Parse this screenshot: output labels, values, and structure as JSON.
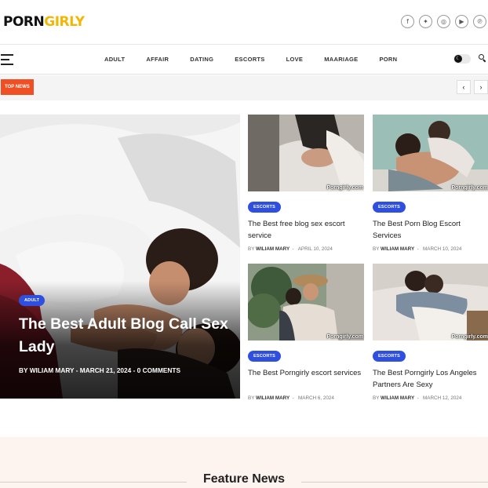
{
  "logo": {
    "part1": "PORN",
    "part2": "GIRLY"
  },
  "socials": [
    {
      "icon": "facebook-icon",
      "glyph": "f"
    },
    {
      "icon": "twitter-icon",
      "glyph": "✦"
    },
    {
      "icon": "instagram-icon",
      "glyph": "◎"
    },
    {
      "icon": "youtube-icon",
      "glyph": "▶"
    },
    {
      "icon": "pinterest-icon",
      "glyph": "℗"
    }
  ],
  "nav": {
    "items": [
      "ADULT",
      "AFFAIR",
      "DATING",
      "ESCORTS",
      "LOVE",
      "MAARIAGE",
      "PORN"
    ]
  },
  "topbar": {
    "label": "TOP NEWS",
    "prev": "‹",
    "next": "›"
  },
  "hero": {
    "category": "ADULT",
    "title": "The Best Adult Blog Call Sex Lady",
    "by": "BY",
    "author": "WILIAM MARY",
    "date": "MARCH 21, 2024",
    "comments": "0 COMMENTS"
  },
  "cards": [
    {
      "category": "ESCORTS",
      "title": "The Best free blog sex escort service",
      "by": "BY",
      "author": "WILIAM MARY",
      "date": "APRIL 10, 2024",
      "watermark": "Porngirly.com"
    },
    {
      "category": "ESCORTS",
      "title": "The Best Porn Blog Escort Services",
      "by": "BY",
      "author": "WILIAM MARY",
      "date": "MARCH 10, 2024",
      "watermark": "Porngirly.com"
    },
    {
      "category": "ESCORTS",
      "title": "The Best Porngirly escort services",
      "by": "BY",
      "author": "WILIAM MARY",
      "date": "MARCH 6, 2024",
      "watermark": "Porngirly.com"
    },
    {
      "category": "ESCORTS",
      "title": "The Best Porngirly Los Angeles Partners Are Sexy",
      "by": "BY",
      "author": "WILIAM MARY",
      "date": "MARCH 12, 2024",
      "watermark": "Porngirly.com"
    }
  ],
  "feature": {
    "title": "Feature News"
  },
  "colors": {
    "accent_logo": "#f2b705",
    "top_news": "#f04e23",
    "badge": "#2f4fe0",
    "feature_bg": "#fdf3ef"
  }
}
